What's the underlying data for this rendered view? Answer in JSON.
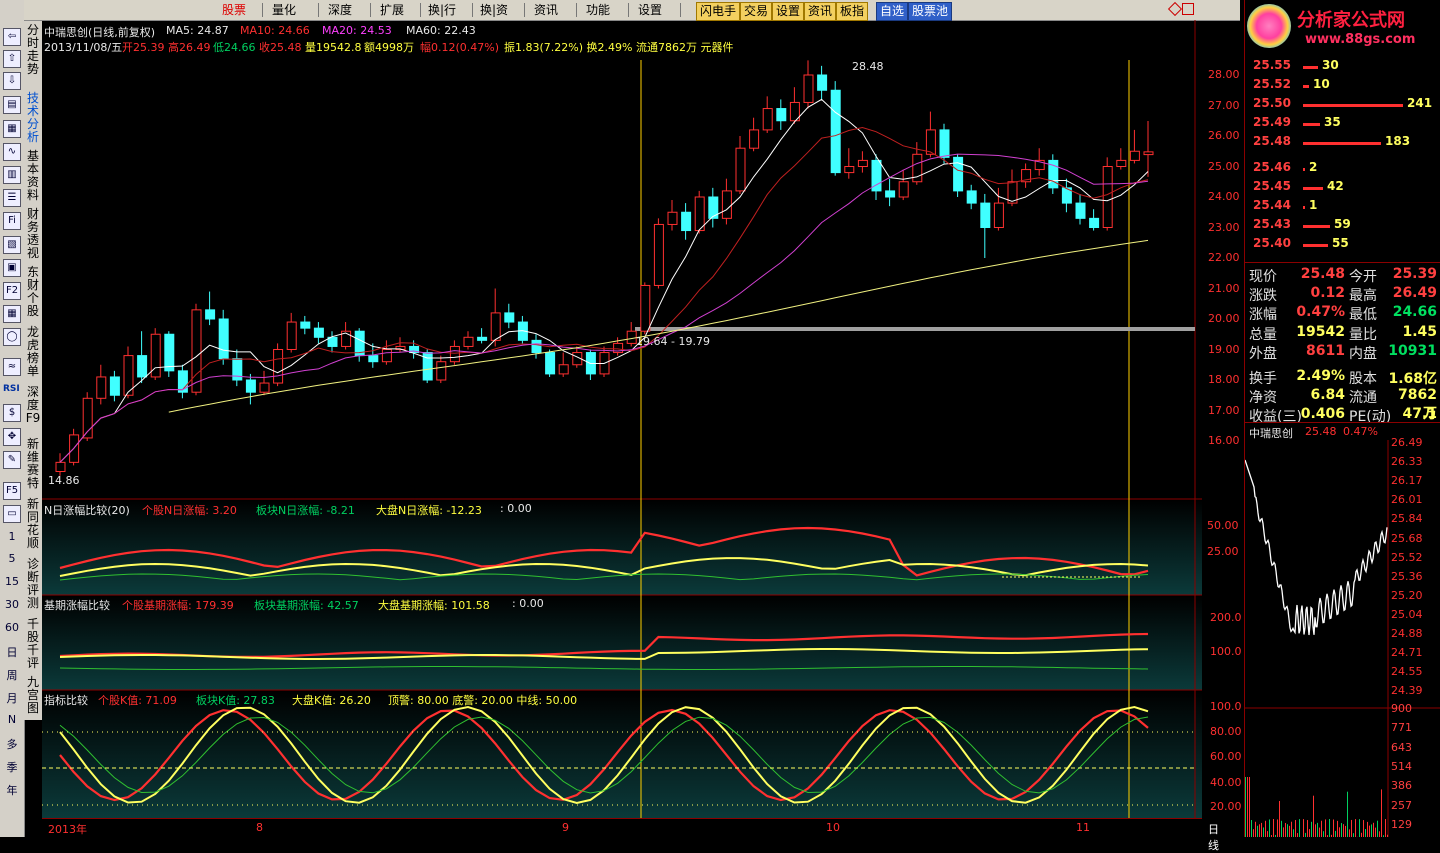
{
  "menubar": {
    "items": [
      "股票",
      "量化",
      "深度",
      "扩展",
      "换|行",
      "换|资",
      "资讯",
      "功能",
      "设置"
    ],
    "tools": [
      "闪电手",
      "交易",
      "设置",
      "资讯",
      "板指",
      "自选",
      "股票池"
    ]
  },
  "sidebar": {
    "vtabs": [
      "分时走势",
      "技术分析",
      "基本资料",
      "财务透视",
      "东财个股",
      "龙虎榜单",
      "深度F9",
      "新维赛特",
      "新同花顺",
      "诊断评测",
      "千股千评",
      "九宫图"
    ],
    "numbers": [
      "1",
      "5",
      "15",
      "30",
      "60",
      "日",
      "周",
      "月",
      "N",
      "多",
      "季",
      "年"
    ],
    "icons": [
      "RSI",
      "Fi",
      "F2",
      "F5"
    ]
  },
  "main_chart": {
    "title": "中瑞思创(日线,前复权)",
    "ma5": "MA5: 24.87",
    "ma10": "MA10: 24.66",
    "ma20": "MA20: 24.53",
    "ma60": "MA60: 22.43",
    "info_date": "2013/11/08/五",
    "info_open": "开25.39",
    "info_high": "高26.49",
    "info_low": "低24.66",
    "info_close": "收25.48",
    "info_vol": "量19542.8",
    "info_amt": "额4998万",
    "info_chg": "幅0.12(0.47%)",
    "info_rest": "振1.83(7.22%) 换2.49% 流通7862万 元器件",
    "high_mark": "28.48",
    "low_mark": "14.86",
    "range_mark": "19.64 - 19.79",
    "price_ticks": [
      "28.00",
      "27.00",
      "26.00",
      "25.00",
      "24.00",
      "23.00",
      "22.00",
      "21.00",
      "20.00",
      "19.00",
      "18.00",
      "17.00",
      "16.00"
    ]
  },
  "panel1": {
    "title": "N日涨幅比较(20)",
    "a": "个股N日涨幅: 3.20",
    "b": "板块N日涨幅: -8.21",
    "c": "大盘N日涨幅: -12.23",
    "d": ": 0.00",
    "ticks": [
      "50.00",
      "25.00"
    ]
  },
  "panel2": {
    "title": "基期涨幅比较",
    "a": "个股基期涨幅: 179.39",
    "b": "板块基期涨幅: 42.57",
    "c": "大盘基期涨幅: 101.58",
    "d": ": 0.00",
    "ticks": [
      "200.0",
      "100.0"
    ]
  },
  "panel3": {
    "title": "指标比较",
    "a": "个股K值: 71.09",
    "b": "板块K值: 27.83",
    "c": "大盘K值: 26.20",
    "d": "顶警: 80.00  底警: 20.00  中线: 50.00",
    "ticks": [
      "100.0",
      "80.00",
      "60.00",
      "40.00",
      "20.00"
    ]
  },
  "bottom_axis": {
    "labels": [
      "2013年",
      "8",
      "9",
      "10",
      "11"
    ],
    "period": "日线"
  },
  "right_panel": {
    "logo": "分析家公式网",
    "logo_url": "www.88gs.com",
    "orderbook": [
      {
        "price": "25.55",
        "vol": "30",
        "bar": 15
      },
      {
        "price": "25.52",
        "vol": "10",
        "bar": 6
      },
      {
        "price": "25.50",
        "vol": "241",
        "bar": 100
      },
      {
        "price": "25.49",
        "vol": "35",
        "bar": 17
      },
      {
        "price": "25.48",
        "vol": "183",
        "bar": 78
      },
      {
        "price": "25.46",
        "vol": "2",
        "bar": 2
      },
      {
        "price": "25.45",
        "vol": "42",
        "bar": 20
      },
      {
        "price": "25.44",
        "vol": "1",
        "bar": 2
      },
      {
        "price": "25.43",
        "vol": "59",
        "bar": 27
      },
      {
        "price": "25.40",
        "vol": "55",
        "bar": 25
      }
    ],
    "quotes": [
      {
        "k1": "现价",
        "v1": "25.48",
        "k2": "今开",
        "v2": "25.39"
      },
      {
        "k1": "涨跌",
        "v1": "0.12",
        "k2": "最高",
        "v2": "26.49"
      },
      {
        "k1": "涨幅",
        "v1": "0.47%",
        "k2": "最低",
        "v2": "24.66"
      },
      {
        "k1": "总量",
        "v1": "19542",
        "k2": "量比",
        "v2": "1.45"
      },
      {
        "k1": "外盘",
        "v1": "8611",
        "k2": "内盘",
        "v2": "10931"
      },
      {
        "k1": "换手",
        "v1": "2.49%",
        "k2": "股本",
        "v2": "1.68亿"
      },
      {
        "k1": "净资",
        "v1": "6.84",
        "k2": "流通",
        "v2": "7862万"
      },
      {
        "k1": "收益(三)",
        "v1": "0.406",
        "k2": "PE(动)",
        "v2": "47.1"
      }
    ],
    "mini_title": "中瑞思创",
    "mini_price": "25.48",
    "mini_pct": "0.47%",
    "mini_ticks": [
      "26.49",
      "26.33",
      "26.17",
      "26.01",
      "25.84",
      "25.68",
      "25.52",
      "25.36",
      "25.20",
      "25.04",
      "24.88",
      "24.71",
      "24.55",
      "24.39"
    ],
    "vol_ticks": [
      "900",
      "771",
      "643",
      "514",
      "386",
      "257",
      "129"
    ]
  }
}
